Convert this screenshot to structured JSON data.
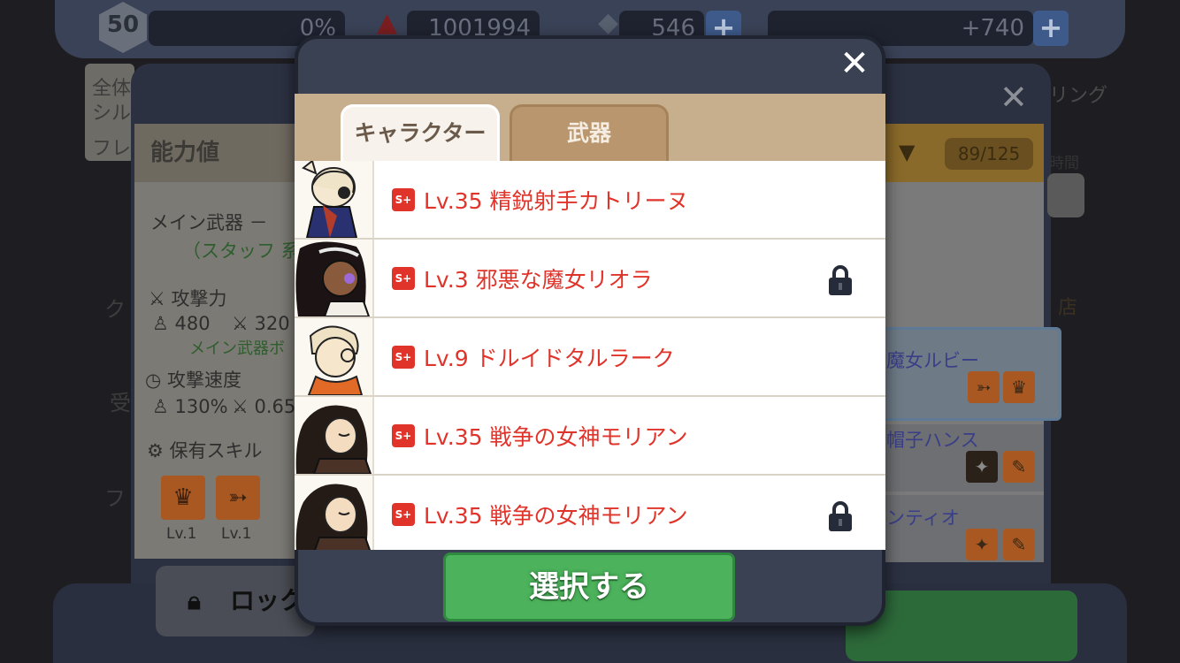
{
  "hud": {
    "level": "50",
    "exp_percent": "0%",
    "gold": "1001994",
    "gems": "546",
    "stamina": "+740",
    "plus": "+"
  },
  "background": {
    "left_header": "能力値",
    "main_weapon_line": "メイン武器 －",
    "weapon_type": "（スタッフ 系",
    "attack_label": "攻撃力",
    "attack_char": "480",
    "attack_weapon": "320",
    "main_weapon_bonus": "メイン武器ボ",
    "speed_label": "攻撃速度",
    "speed_char": "130%",
    "speed_weapon": "0.65",
    "skills_label": "保有スキル",
    "skill_levels": [
      "Lv.1",
      "Lv.1"
    ],
    "lock_button": "ロック",
    "count": "89/125",
    "time_label": "時間",
    "shop_label": "店",
    "side_left_1": "全体",
    "side_left_2": "シル",
    "side_left_3": "フレ",
    "side_right_top": "リング",
    "side_icons_left": [
      "ク",
      "受",
      "フ"
    ],
    "right_cards": [
      "魔女ルビー",
      "帽子ハンス",
      "ンティオ"
    ]
  },
  "modal": {
    "close_icon": "✕",
    "tabs": [
      {
        "label": "キャラクター",
        "active": true
      },
      {
        "label": "武器",
        "active": false
      }
    ],
    "rows": [
      {
        "rank": "S+",
        "text": "Lv.35  精鋭射手カトリーヌ",
        "locked": false,
        "portrait": "archer"
      },
      {
        "rank": "S+",
        "text": "Lv.3  邪悪な魔女リオラ",
        "locked": true,
        "portrait": "witch"
      },
      {
        "rank": "S+",
        "text": "Lv.9  ドルイドタルラーク",
        "locked": false,
        "portrait": "druid"
      },
      {
        "rank": "S+",
        "text": "Lv.35  戦争の女神モリアン",
        "locked": false,
        "portrait": "goddess"
      },
      {
        "rank": "S+",
        "text": "Lv.35  戦争の女神モリアン",
        "locked": true,
        "portrait": "goddess"
      }
    ],
    "select_button": "選択する"
  },
  "colors": {
    "accent_red": "#e0342b",
    "button_green": "#4cb35c",
    "tab_tan": "#b9966e",
    "modal_navy": "#3a4152"
  }
}
